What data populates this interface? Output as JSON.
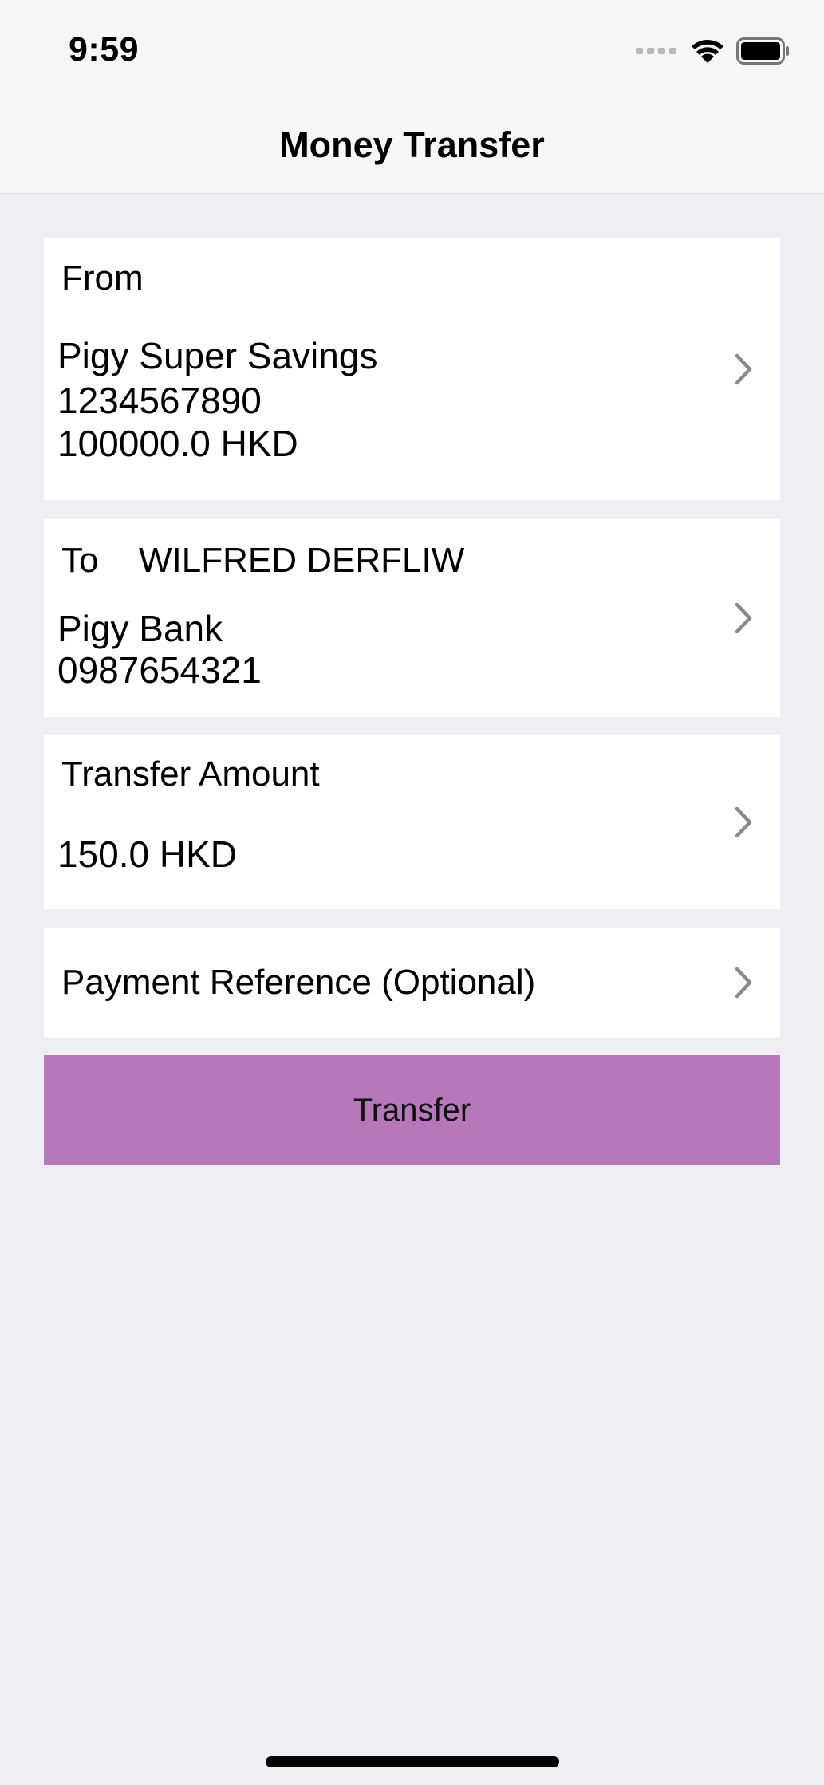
{
  "status_bar": {
    "time": "9:59",
    "icons": [
      "signal-icon",
      "wifi-icon",
      "battery-icon"
    ]
  },
  "nav": {
    "title": "Money Transfer"
  },
  "from_card": {
    "label": "From",
    "account_name": "Pigy Super Savings",
    "account_number": "1234567890",
    "balance": "100000.0 HKD",
    "icon": "chevron-right-icon"
  },
  "to_card": {
    "label": "To",
    "payee_name": "WILFRED DERFLIW",
    "bank_name": "Pigy Bank",
    "account_number": "0987654321",
    "icon": "chevron-right-icon"
  },
  "amount_card": {
    "label": "Transfer Amount",
    "value": "150.0 HKD",
    "icon": "chevron-right-icon"
  },
  "reference_card": {
    "label": "Payment Reference (Optional)",
    "icon": "chevron-right-icon"
  },
  "transfer_button": {
    "label": "Transfer",
    "color": "#b778bb"
  },
  "colors": {
    "background": "#efeef4",
    "card": "#ffffff",
    "chevron": "#8a8a8e"
  }
}
